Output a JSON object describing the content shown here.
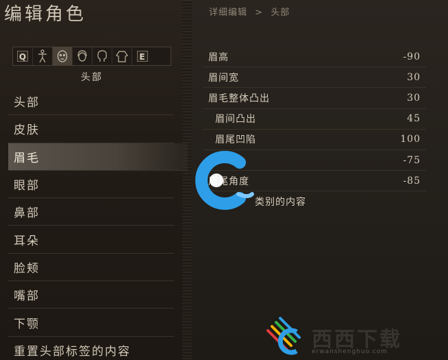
{
  "app_title": "编辑角色",
  "breadcrumb": {
    "parent": "详细编辑",
    "separator": ">",
    "current": "头部"
  },
  "icon_bar": {
    "items": [
      {
        "kind": "key",
        "label": "Q",
        "icon": "q-key-icon"
      },
      {
        "kind": "icon",
        "icon": "body-icon"
      },
      {
        "kind": "icon",
        "icon": "face-icon",
        "active": true
      },
      {
        "kind": "icon",
        "icon": "hair-icon"
      },
      {
        "kind": "icon",
        "icon": "head-profile-icon"
      },
      {
        "kind": "icon",
        "icon": "torso-icon"
      },
      {
        "kind": "key",
        "label": "E",
        "icon": "e-key-icon"
      }
    ]
  },
  "section_heading": "头部",
  "menu": {
    "selected_index": 2,
    "items": [
      {
        "label": "头部"
      },
      {
        "label": "皮肤"
      },
      {
        "label": "眉毛"
      },
      {
        "label": "眼部"
      },
      {
        "label": "鼻部"
      },
      {
        "label": "耳朵"
      },
      {
        "label": "脸颊"
      },
      {
        "label": "嘴部"
      },
      {
        "label": "下颚"
      },
      {
        "label": "重置头部标签的内容"
      }
    ]
  },
  "properties": {
    "rows": [
      {
        "label": "眉高",
        "value": "-90",
        "indent": false
      },
      {
        "label": "眉间宽",
        "value": "30",
        "indent": false
      },
      {
        "label": "眉毛整体凸出",
        "value": "30",
        "indent": false
      },
      {
        "label": "眉间凸出",
        "value": "45",
        "indent": true
      },
      {
        "label": "眉尾凹陷",
        "value": "100",
        "indent": true
      },
      {
        "label": "",
        "value": "-75",
        "indent": false
      },
      {
        "label": "眉尾角度",
        "value": "-85",
        "indent": false
      },
      {
        "label": "类别的内容",
        "value": "",
        "indent": false,
        "reset": true
      }
    ]
  },
  "watermark": {
    "brand_text": "西西下载",
    "url_text": "erwanshenghuo.com",
    "accent_color": "#2e9ee8"
  },
  "colors": {
    "background": "#1c1814",
    "text": "#d8cfc0",
    "selected_row": "#5a544c"
  }
}
